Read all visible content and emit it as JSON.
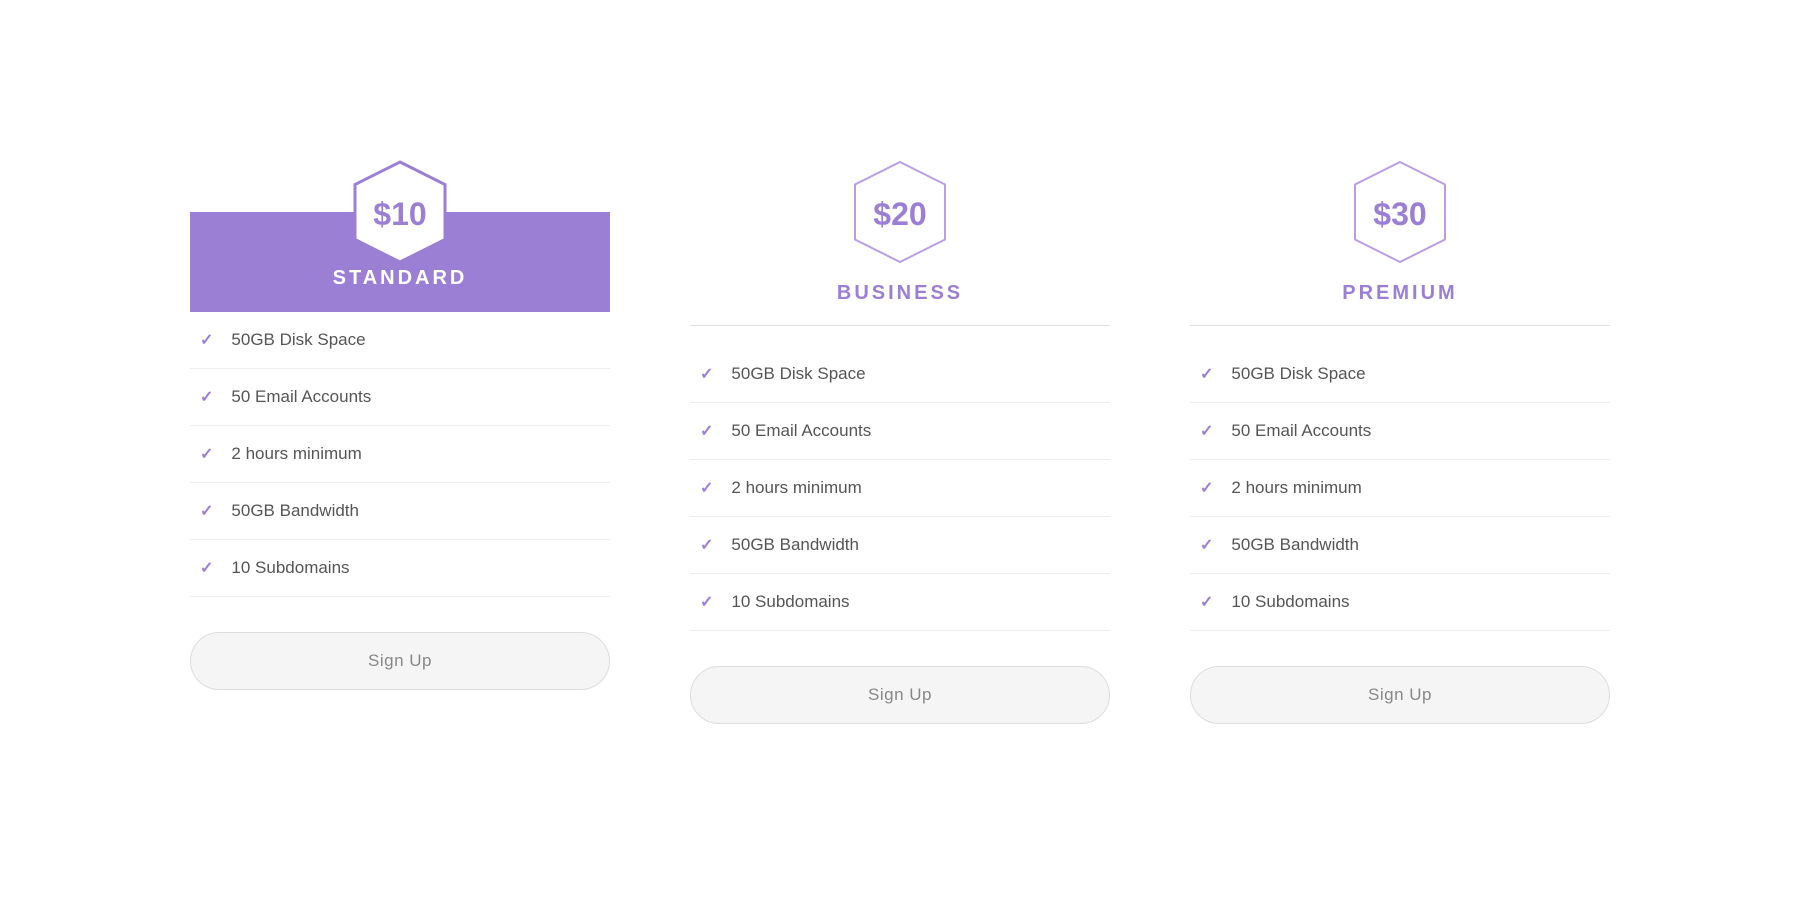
{
  "plans": [
    {
      "id": "standard",
      "price": "$10",
      "name": "STANDARD",
      "style": "filled",
      "features": [
        "50GB Disk Space",
        "50 Email Accounts",
        "2 hours minimum",
        "50GB Bandwidth",
        "10 Subdomains"
      ],
      "button_label": "Sign Up"
    },
    {
      "id": "business",
      "price": "$20",
      "name": "BUSINESS",
      "style": "outline",
      "features": [
        "50GB Disk Space",
        "50 Email Accounts",
        "2 hours minimum",
        "50GB Bandwidth",
        "10 Subdomains"
      ],
      "button_label": "Sign Up"
    },
    {
      "id": "premium",
      "price": "$30",
      "name": "PREMIUM",
      "style": "outline",
      "features": [
        "50GB Disk Space",
        "50 Email Accounts",
        "2 hours minimum",
        "50GB Bandwidth",
        "10 Subdomains"
      ],
      "button_label": "Sign Up"
    }
  ],
  "check_symbol": "✓"
}
